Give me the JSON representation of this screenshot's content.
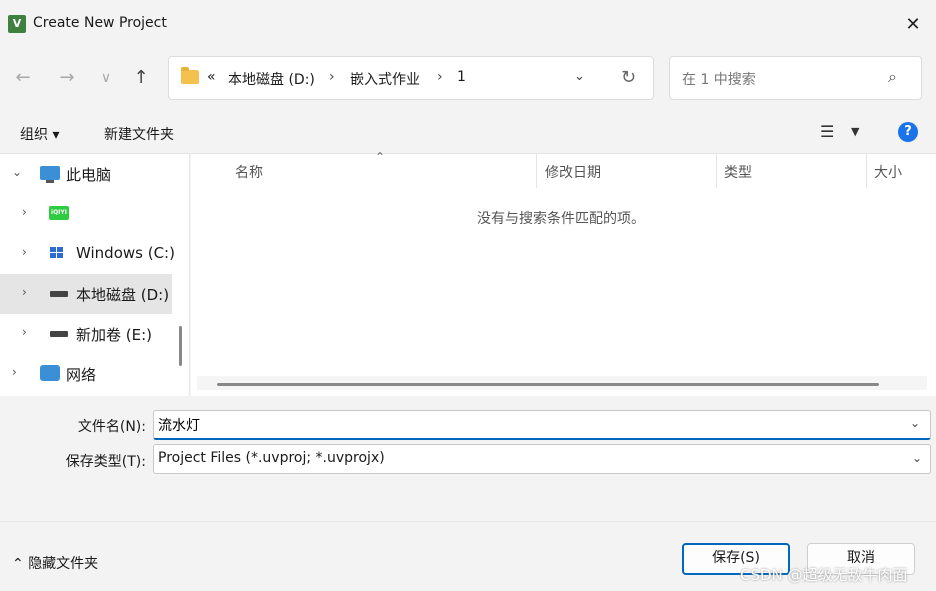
{
  "window": {
    "title": "Create New Project",
    "app_icon": "V",
    "close": "✕"
  },
  "nav": {
    "back": "←",
    "forward": "→",
    "recent": "∨",
    "up": "↑"
  },
  "address": {
    "prefix": "«",
    "crumbs": [
      "本地磁盘 (D:)",
      "嵌入式作业",
      "1"
    ],
    "separator": "›"
  },
  "search": {
    "placeholder": "在 1 中搜索"
  },
  "toolbar": {
    "organize": "组织 ▾",
    "new_folder": "新建文件夹",
    "help": "?"
  },
  "sidebar": {
    "items": [
      {
        "label": "此电脑",
        "expanded": true
      },
      {
        "label": ""
      },
      {
        "label": "Windows (C:)"
      },
      {
        "label": "本地磁盘 (D:)",
        "selected": true
      },
      {
        "label": "新加卷 (E:)"
      },
      {
        "label": "网络"
      }
    ],
    "iqiyi_text": "iQIYI"
  },
  "list": {
    "columns": [
      "名称",
      "修改日期",
      "类型",
      "大小"
    ],
    "empty_message": "没有与搜索条件匹配的项。"
  },
  "form": {
    "filename_label": "文件名(N):",
    "filename_value": "流水灯",
    "filetype_label": "保存类型(T):",
    "filetype_value": "Project Files (*.uvproj; *.uvprojx)"
  },
  "footer": {
    "hide_folders": "隐藏文件夹",
    "save": "保存(S)",
    "cancel": "取消"
  },
  "watermark": "CSDN @超级无敌牛肉面",
  "colors": {
    "accent": "#0067c0",
    "selected_bg": "#e5e5e5",
    "help": "#1a73e8"
  }
}
